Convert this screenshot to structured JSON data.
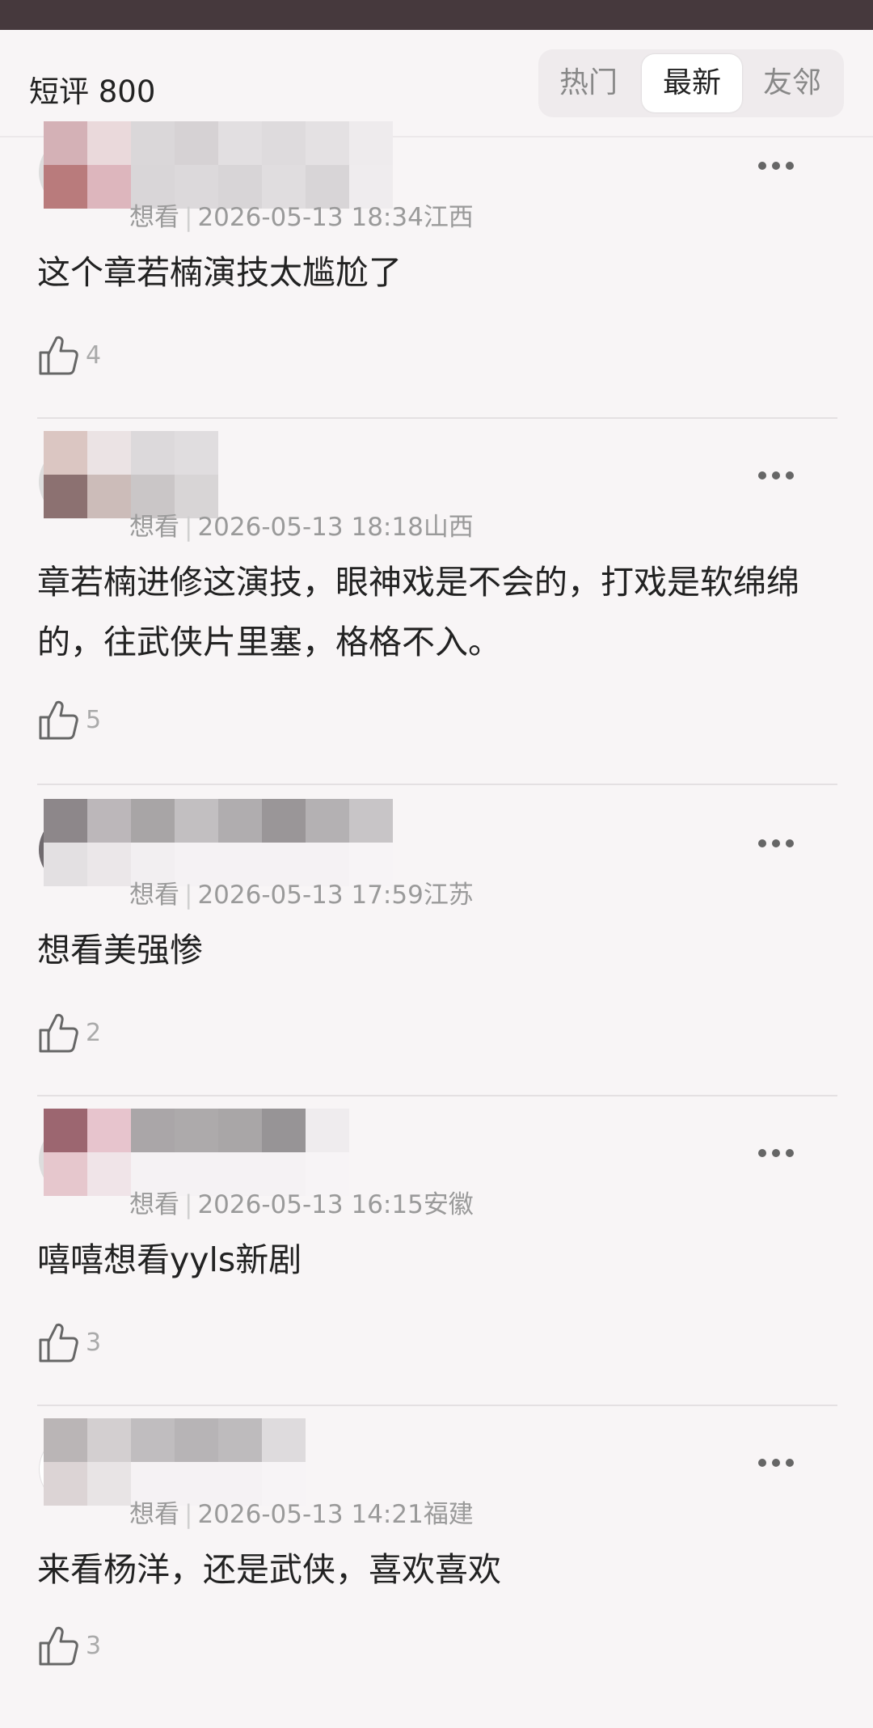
{
  "header": {
    "title": "短评 800",
    "tabs": [
      {
        "label": "热门",
        "active": false
      },
      {
        "label": "最新",
        "active": true
      },
      {
        "label": "友邻",
        "active": false
      }
    ]
  },
  "comments": [
    {
      "status": "想看",
      "time": "2026-05-13 18:34",
      "region": "江西",
      "text": "这个章若楠演技太尴尬了",
      "likes": "4"
    },
    {
      "status": "想看",
      "time": "2026-05-13 18:18",
      "region": "山西",
      "text": "章若楠进修这演技，眼神戏是不会的，打戏是软绵绵的，往武侠片里塞，格格不入。",
      "likes": "5"
    },
    {
      "status": "想看",
      "time": "2026-05-13 17:59",
      "region": "江苏",
      "text": "想看美强惨",
      "likes": "2"
    },
    {
      "status": "想看",
      "time": "2026-05-13 16:15",
      "region": "安徽",
      "text": "嘻嘻想看yyls新剧",
      "likes": "3"
    },
    {
      "status": "想看",
      "time": "2026-05-13 14:21",
      "region": "福建",
      "text": "来看杨洋，还是武侠，喜欢喜欢",
      "likes": "3"
    }
  ],
  "icons": {
    "like": "thumbs-up-icon",
    "more": "more-dots-icon"
  },
  "colors": {
    "background": "#f8f5f6",
    "topbar": "#46393d",
    "text": "#222222",
    "meta": "#9a9a9a"
  }
}
